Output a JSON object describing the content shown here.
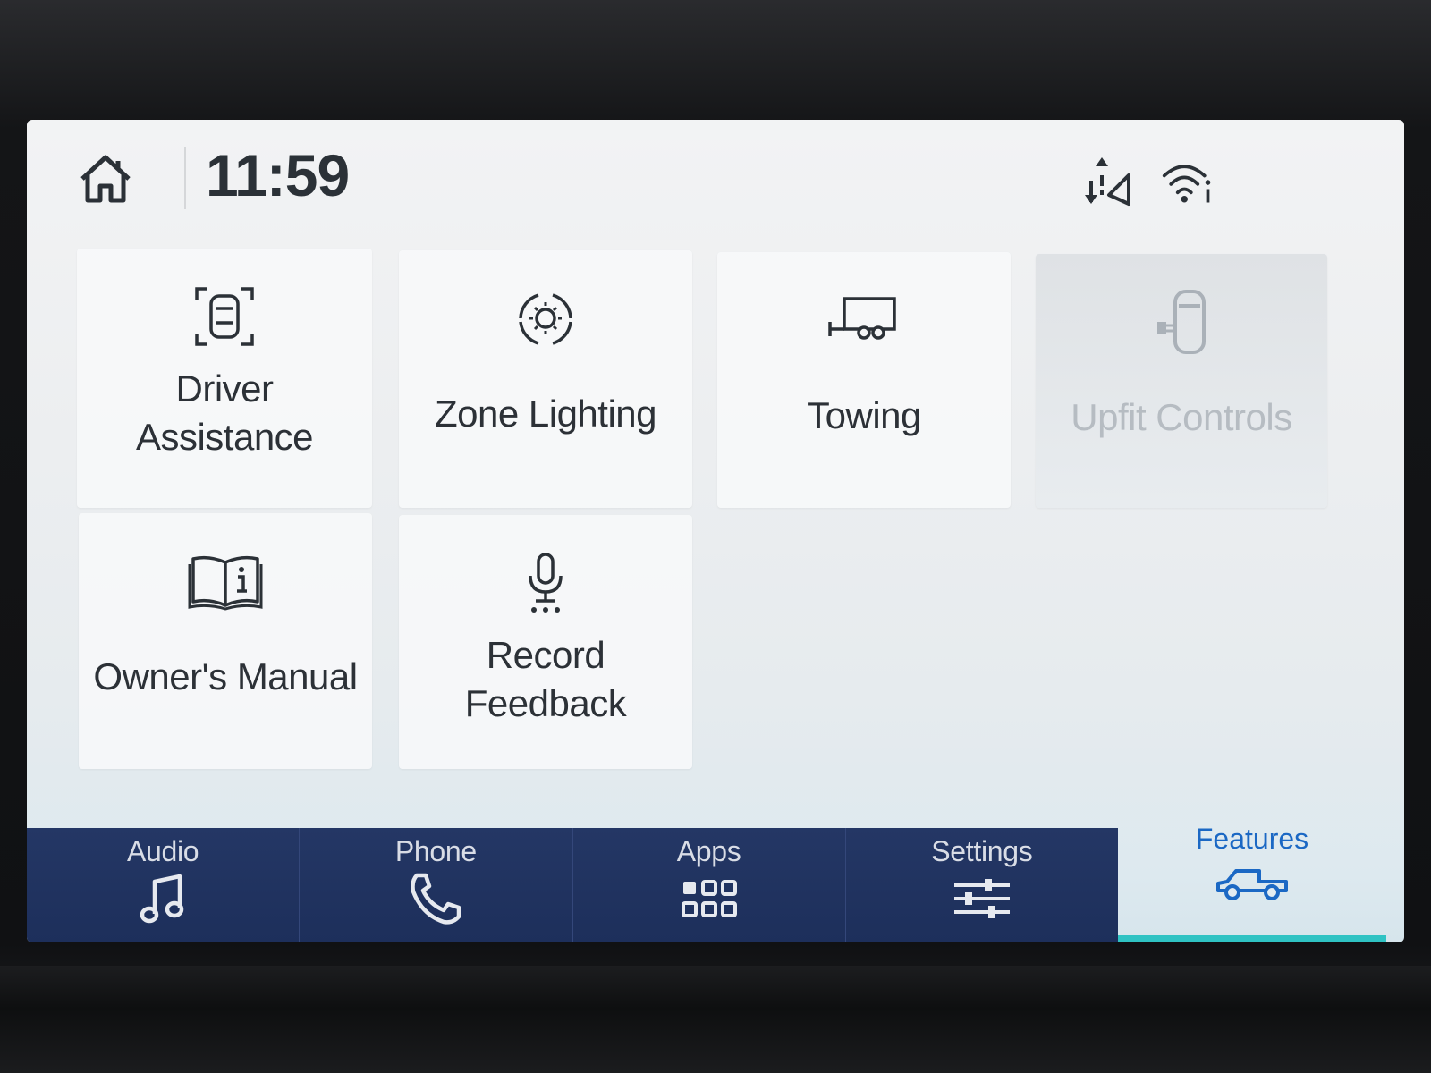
{
  "status_bar": {
    "time": "11:59"
  },
  "tiles": [
    {
      "label_lines": [
        "Driver",
        "Assistance"
      ],
      "icon": "driver-assist-icon",
      "enabled": true
    },
    {
      "label_lines": [
        "Zone Lighting"
      ],
      "icon": "zone-lighting-icon",
      "enabled": true
    },
    {
      "label_lines": [
        "Towing"
      ],
      "icon": "trailer-icon",
      "enabled": true
    },
    {
      "label_lines": [
        "Upfit Controls"
      ],
      "icon": "upfit-icon",
      "enabled": false
    },
    {
      "label_lines": [
        "Owner's Manual"
      ],
      "icon": "manual-book-icon",
      "enabled": true
    },
    {
      "label_lines": [
        "Record",
        "Feedback"
      ],
      "icon": "microphone-icon",
      "enabled": true
    }
  ],
  "nav": {
    "audio": "Audio",
    "phone": "Phone",
    "apps": "Apps",
    "settings": "Settings",
    "features": "Features"
  },
  "colors": {
    "nav_background": "#1f3260",
    "active_accent": "#1b68c4",
    "active_bar": "#2fc3c3",
    "text_dark": "#2c3137",
    "text_disabled": "#b6bcc2"
  }
}
